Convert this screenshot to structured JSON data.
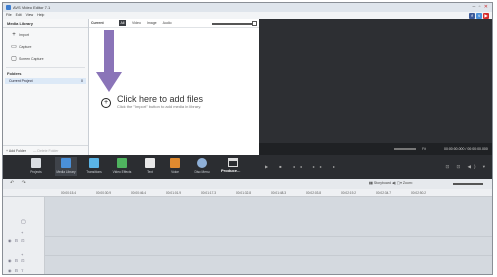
{
  "window": {
    "title": "AVS Video Editor 7.1",
    "controls": [
      "–",
      "▫",
      "✕"
    ]
  },
  "menu": [
    "File",
    "Edit",
    "View",
    "Help"
  ],
  "social": [
    {
      "label": "f",
      "color": "#3b5998"
    },
    {
      "label": "t",
      "color": "#4a90d9"
    },
    {
      "label": "▶",
      "color": "#d62b2b"
    }
  ],
  "library": {
    "title": "Media Library",
    "import_label": "Import",
    "capture_label": "Capture",
    "screen_capture_label": "Screen Capture",
    "folders_title": "Folders",
    "current_project": "Current Project",
    "current_project_count": "0",
    "add_folder": "+ Add Folder",
    "delete_folder": "— Delete Folder"
  },
  "content": {
    "title": "Current",
    "tabs": [
      "All",
      "Video",
      "Image",
      "Audio"
    ],
    "add_files": "Click here to add files",
    "add_hint": "Click the \"Import\" button to add media in library."
  },
  "preview": {
    "fit": "Fit",
    "time": "00:00:00.000 / 00:00:00.000"
  },
  "toolbar": {
    "items": [
      {
        "label": "Projects",
        "color": "#d9dde2"
      },
      {
        "label": "Media Library",
        "color": "#4a90d9"
      },
      {
        "label": "Transitions",
        "color": "#5ab4e6"
      },
      {
        "label": "Video Effects",
        "color": "#4fb35f"
      },
      {
        "label": "Text",
        "color": "#e8e8e8"
      },
      {
        "label": "Voice",
        "color": "#e08a2f"
      },
      {
        "label": "Disc Menu",
        "color": "#8fb0d8"
      }
    ],
    "produce": "Produce...",
    "player": "▶ ■ ◂◂ ▸▸ ▸",
    "right": "⊡ ⊡ ◀) ▾"
  },
  "timeline": {
    "undo": "↶ ↷",
    "storyboard": "Storyboard",
    "zoom": "Zoom:",
    "ticks": [
      "00:00:15.4",
      "00:00:30.9",
      "00:00:46.4",
      "00:01:01.9",
      "00:01:17.3",
      "00:01:32.8",
      "00:01:48.3",
      "00:02:03.8",
      "00:02:19.2",
      "00:02:34.7",
      "00:02:50.2"
    ]
  }
}
